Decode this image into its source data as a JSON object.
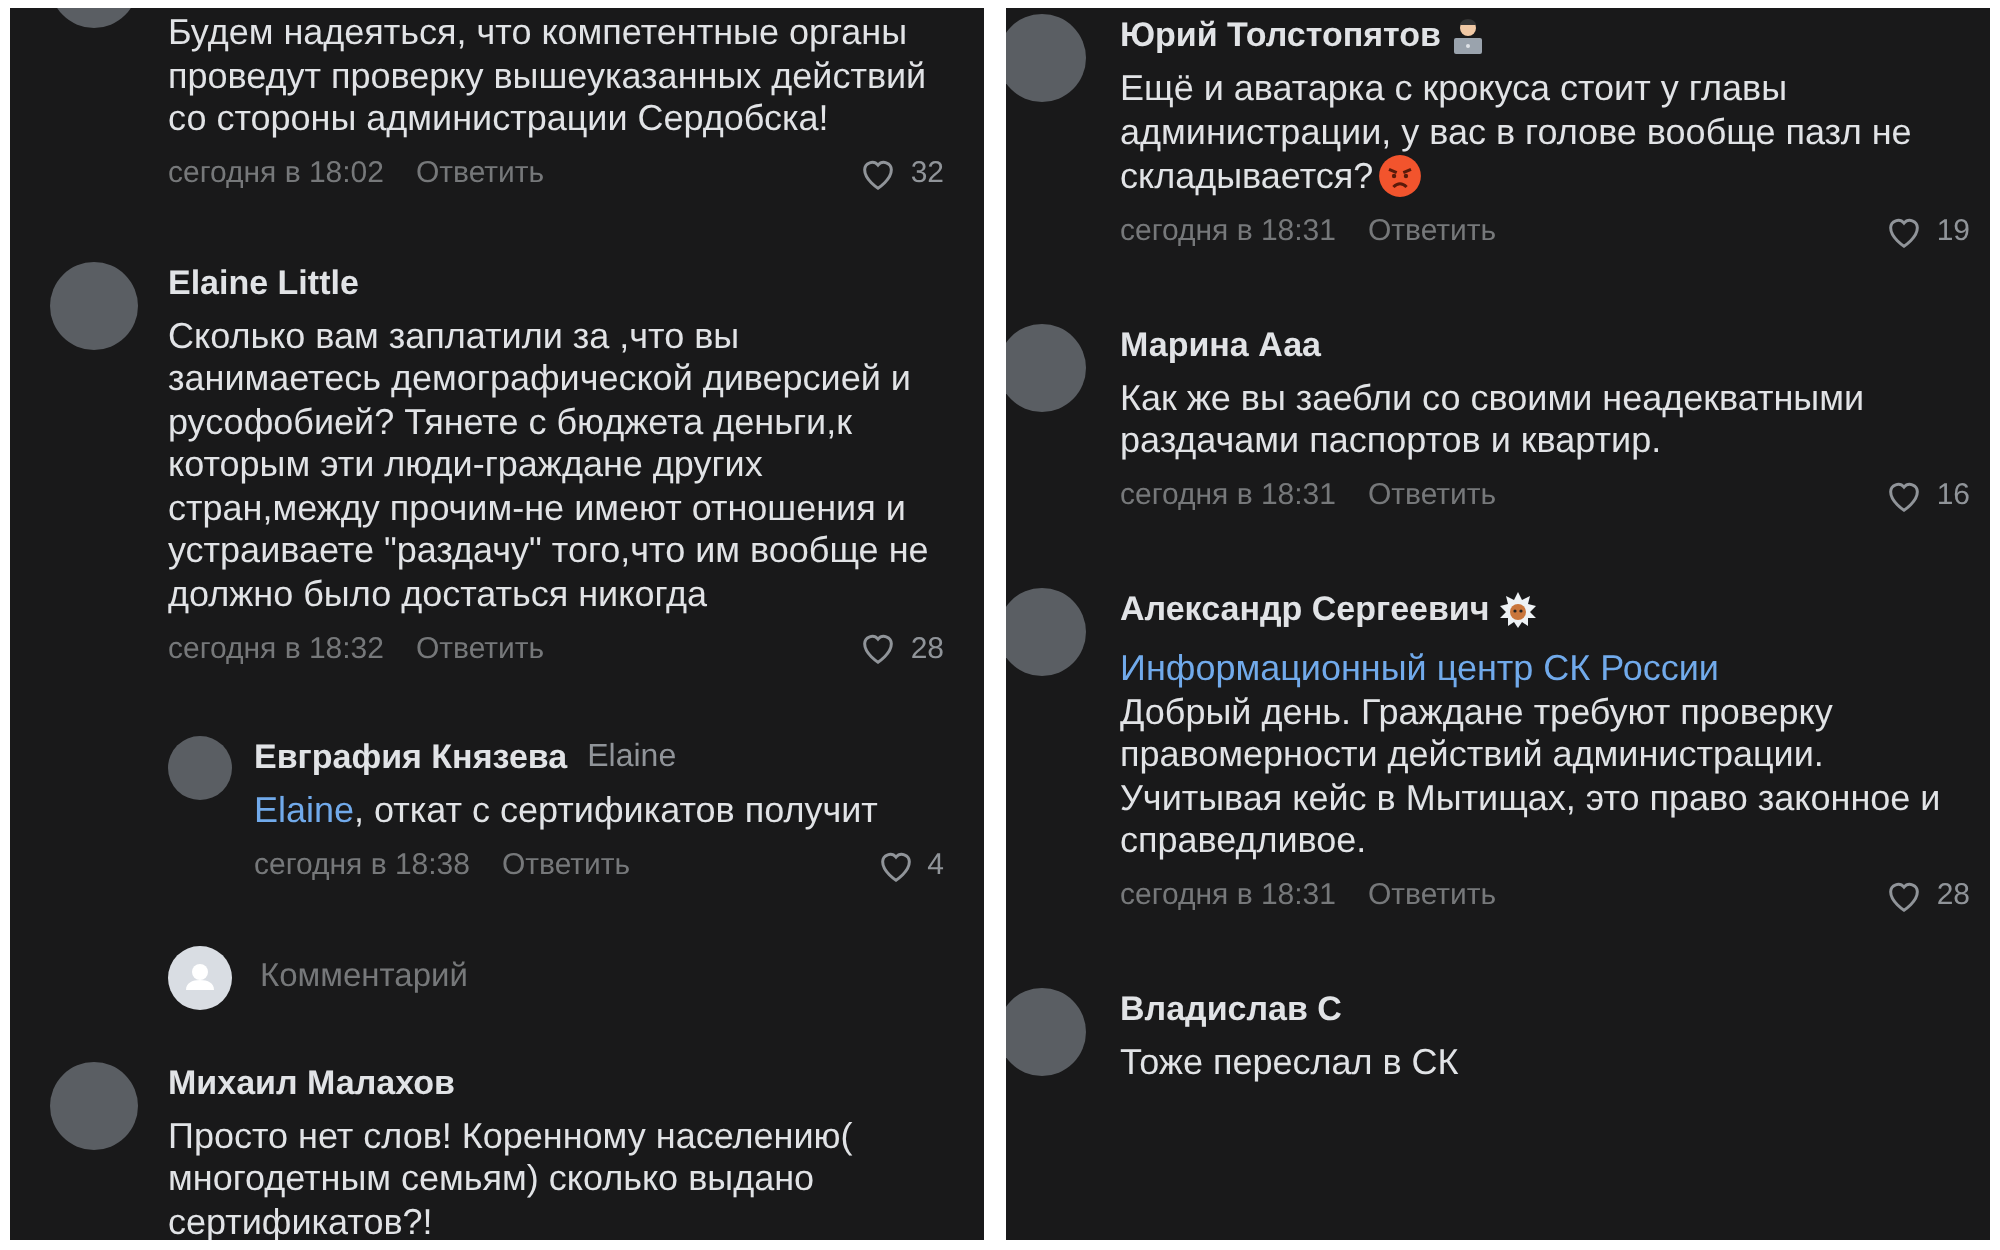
{
  "panels": [
    {
      "comments": [
        {
          "kind": "comment",
          "text": "Будем надеяться, что компетентные органы проведут проверку вышеуказанных действий со стороны администрации Сердобска!",
          "time": "сегодня в 18:02",
          "reply_label": "Ответить",
          "likes": "32"
        },
        {
          "kind": "comment",
          "author": "Elaine Little",
          "text": "Сколько вам заплатили за ,что вы занимаетесь демографической диверсией и  русофобией? Тянете с бюджета деньги,к которым  эти люди-граждане других стран,между прочим-не имеют отношения и устраиваете \"раздачу\" того,что им вообще не должно было достаться никогда",
          "time": "сегодня в 18:32",
          "reply_label": "Ответить",
          "likes": "28",
          "children": [
            {
              "kind": "reply",
              "author": "Евграфия Князева",
              "reply_to": "Elaine",
              "mention": "Elaine",
              "text": ", откат с сертификатов получит",
              "time": "сегодня в 18:38",
              "reply_label": "Ответить",
              "likes": "4"
            },
            {
              "kind": "composer",
              "placeholder": "Комментарий"
            }
          ]
        },
        {
          "kind": "comment",
          "author": "Михаил Малахов",
          "text": "Просто нет слов! Коренному населению( многодетным семьям) сколько выдано сертификатов?!"
        }
      ]
    },
    {
      "comments": [
        {
          "kind": "comment",
          "author": "Юрий Толстопятов",
          "laptop_badge": true,
          "text": "Ещё и аватарка с крокуса стоит у главы администрации, у вас в голове вообще пазл не складывается?",
          "angry_emoji": true,
          "time": "сегодня в 18:31",
          "reply_label": "Ответить",
          "likes": "19"
        },
        {
          "kind": "comment",
          "author": "Марина Ааа",
          "text": "Как же вы заебли со своими неадекватными раздачами паспортов и квартир.",
          "time": "сегодня в 18:31",
          "reply_label": "Ответить",
          "likes": "16"
        },
        {
          "kind": "comment",
          "author": "Александр Сергеевич",
          "spiky_badge": true,
          "link": "Информационный центр СК России",
          "text": "Добрый день. Граждане требуют проверку правомерности действий администрации. Учитывая кейс в Мытищах, это право законное и справедливое.",
          "time": "сегодня в 18:31",
          "reply_label": "Ответить",
          "likes": "28"
        },
        {
          "kind": "comment",
          "author": "Владислав С",
          "text": "Тоже переслал в СК"
        }
      ]
    }
  ]
}
